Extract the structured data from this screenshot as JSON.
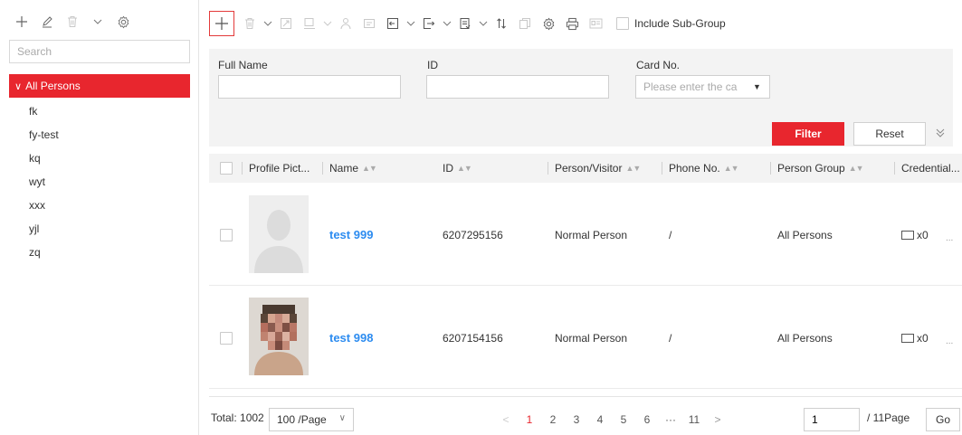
{
  "left_panel": {
    "search_placeholder": "Search",
    "tree": {
      "root_label": "All Persons",
      "children": [
        "fk",
        "fy-test",
        "kq",
        "wyt",
        "xxx",
        "yjl",
        "zq"
      ]
    },
    "icons": [
      "add-icon",
      "edit-icon",
      "delete-icon",
      "chevron-down-icon",
      "gear-icon"
    ]
  },
  "toolbar": {
    "include_subgroup_label": "Include Sub-Group"
  },
  "filter": {
    "full_name_label": "Full Name",
    "id_label": "ID",
    "card_no_label": "Card No.",
    "card_no_placeholder": "Please enter the card number.",
    "filter_button": "Filter",
    "reset_button": "Reset"
  },
  "table": {
    "columns": [
      "Profile Pict...",
      "Name",
      "ID",
      "Person/Visitor",
      "Phone No.",
      "Person Group",
      "Credential..."
    ],
    "rows": [
      {
        "name": "test 999",
        "id": "6207295156",
        "type": "Normal Person",
        "phone": "/",
        "group": "All Persons",
        "credential": "x0",
        "more": "..."
      },
      {
        "name": "test 998",
        "id": "6207154156",
        "type": "Normal Person",
        "phone": "/",
        "group": "All Persons",
        "credential": "x0",
        "more": "..."
      }
    ]
  },
  "footer": {
    "total": "Total: 1002",
    "page_size": "100 /Page",
    "pages": [
      "1",
      "2",
      "3",
      "4",
      "5",
      "6",
      "···",
      "11"
    ],
    "active_page": "1",
    "jump_value": "1",
    "total_pages": "/ 11Page",
    "go_button": "Go"
  },
  "colors": {
    "accent": "#e8262e",
    "link": "#2d8cf0",
    "filter_bg": "#f3f3f3"
  }
}
